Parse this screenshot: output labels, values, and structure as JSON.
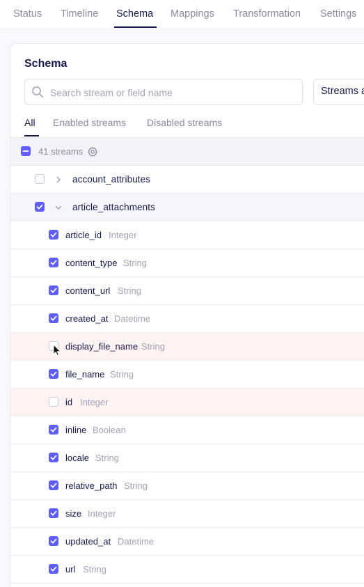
{
  "topnav": {
    "tabs": [
      {
        "label": "Status",
        "active": false
      },
      {
        "label": "Timeline",
        "active": false
      },
      {
        "label": "Schema",
        "active": true
      },
      {
        "label": "Mappings",
        "active": false
      },
      {
        "label": "Transformation",
        "active": false
      },
      {
        "label": "Settings",
        "active": false
      }
    ]
  },
  "schema": {
    "title": "Schema",
    "search_placeholder": "Search stream or field name",
    "filter_select_label": "Streams a",
    "subtabs": [
      {
        "label": "All",
        "active": true
      },
      {
        "label": "Enabled streams",
        "active": false
      },
      {
        "label": "Disabled streams",
        "active": false
      }
    ],
    "streams_count": "41 streams"
  },
  "streams": [
    {
      "name": "account_attributes",
      "checked": false,
      "expanded": false
    },
    {
      "name": "article_attachments",
      "checked": true,
      "expanded": true
    }
  ],
  "fields": [
    {
      "name": "article_id",
      "type": "Integer",
      "checked": true
    },
    {
      "name": "content_type",
      "type": "String",
      "checked": true
    },
    {
      "name": "content_url",
      "type": "String",
      "checked": true
    },
    {
      "name": "created_at",
      "type": "Datetime",
      "checked": true
    },
    {
      "name": "display_file_name",
      "type": "String",
      "checked": false
    },
    {
      "name": "file_name",
      "type": "String",
      "checked": true
    },
    {
      "name": "id",
      "type": "Integer",
      "checked": false
    },
    {
      "name": "inline",
      "type": "Boolean",
      "checked": true
    },
    {
      "name": "locale",
      "type": "String",
      "checked": true
    },
    {
      "name": "relative_path",
      "type": "String",
      "checked": true
    },
    {
      "name": "size",
      "type": "Integer",
      "checked": true
    },
    {
      "name": "updated_at",
      "type": "Datetime",
      "checked": true
    },
    {
      "name": "url",
      "type": "String",
      "checked": true
    }
  ],
  "colors": {
    "accent": "#615eff",
    "text_primary": "#1a194d",
    "text_muted": "#a3a3b5",
    "disabled_row_bg": "#fdf3f3"
  },
  "icons": {
    "search": "search-icon",
    "gear": "gear-icon",
    "chevron_right": "chevron-right-icon",
    "chevron_down": "chevron-down-icon",
    "cursor": "mouse-pointer-icon"
  }
}
